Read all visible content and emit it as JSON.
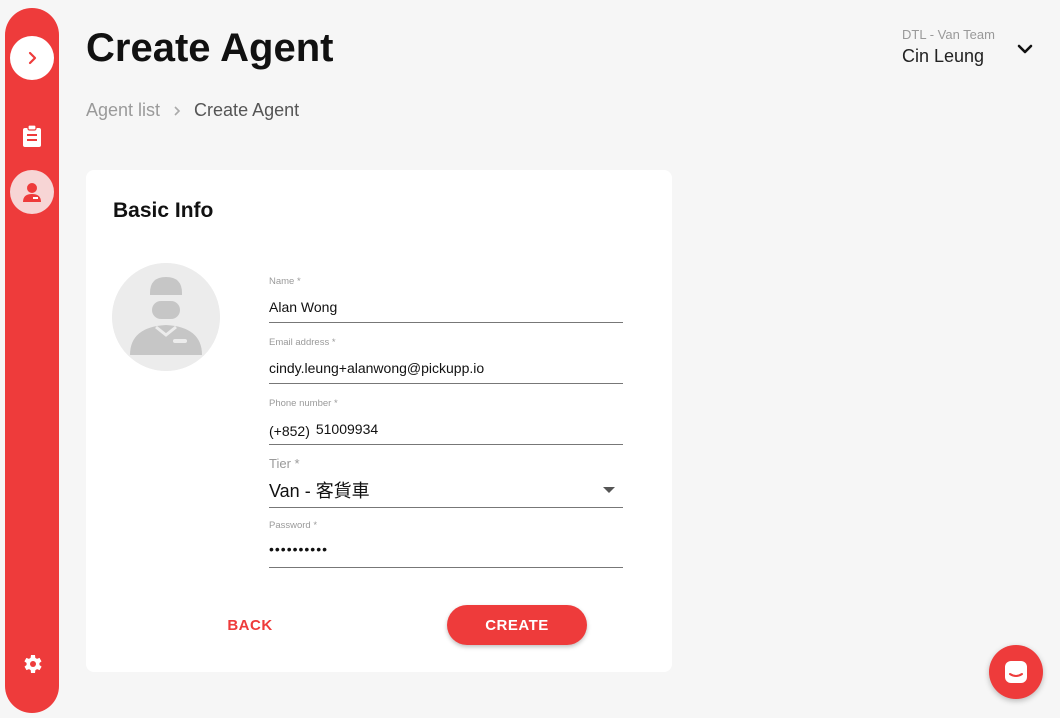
{
  "sidebar": {
    "expand_icon": "chevron-right-icon",
    "items": [
      {
        "name": "agent-list-nav",
        "icon": "clipboard-icon"
      },
      {
        "name": "agents-nav",
        "icon": "agent-icon",
        "active": true
      },
      {
        "name": "settings-nav",
        "icon": "gear-icon"
      }
    ],
    "color": "#ee3b3b"
  },
  "header": {
    "title": "Create Agent",
    "breadcrumb": [
      "Agent list",
      "Create Agent"
    ],
    "team": "DTL - Van Team",
    "user": "Cin Leung"
  },
  "card": {
    "title": "Basic Info",
    "fields": {
      "name": {
        "label": "Name *",
        "value": "Alan Wong"
      },
      "email": {
        "label": "Email address *",
        "value": "cindy.leung+alanwong@pickupp.io"
      },
      "phone": {
        "label": "Phone number *",
        "prefix": "(+852)",
        "value": "51009934"
      },
      "tier": {
        "label": "Tier *",
        "value": "Van - 客貨車"
      },
      "password": {
        "label": "Password *",
        "value": "••••••••••"
      }
    },
    "back_label": "BACK",
    "create_label": "CREATE"
  },
  "chat_icon": "chat-icon",
  "accent": "#ee3b3b"
}
